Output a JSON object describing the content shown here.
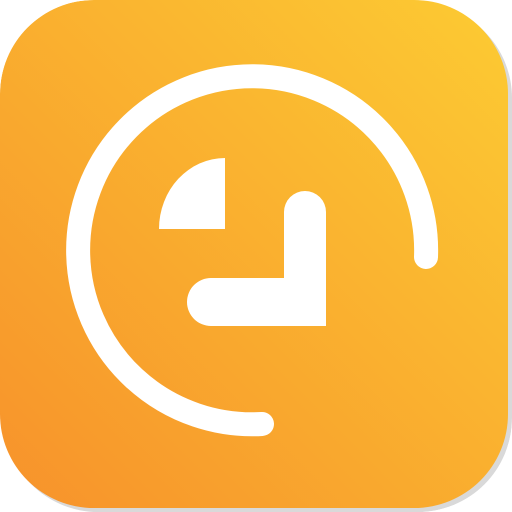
{
  "app_icon": {
    "glyph": "clock-icon",
    "colors": {
      "gradient_start": "#F7922B",
      "gradient_end": "#FCCB33",
      "glyph": "#FFFFFF",
      "rim_shadow": "#D9D9D9"
    }
  }
}
